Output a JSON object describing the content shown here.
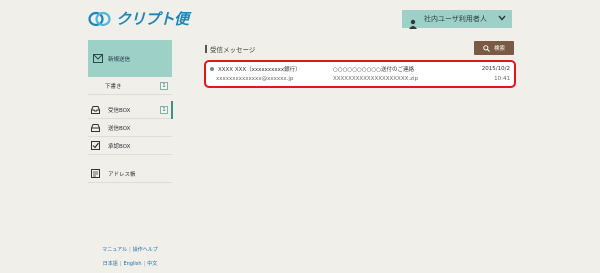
{
  "header": {
    "logo_text": "クリプト便",
    "user_name": "社内ユーザ利用者人",
    "user_icon": "person-icon",
    "dropdown_icon": "chevron-down-icon"
  },
  "sidebar": {
    "compose_label": "新規送信",
    "items": [
      {
        "label": "下書き",
        "count": "1",
        "icon": ""
      },
      {
        "label": "受信BOX",
        "count": "1",
        "icon": "inbox-icon"
      },
      {
        "label": "送信BOX",
        "count": "",
        "icon": "outbox-icon"
      },
      {
        "label": "承認BOX",
        "count": "",
        "icon": "checkbox-icon"
      },
      {
        "label": "アドレス帳",
        "count": "",
        "icon": "address-book-icon"
      }
    ],
    "help_links": [
      "マニュアル",
      "操作ヘルプ"
    ],
    "languages": [
      "日本語",
      "English",
      "中文"
    ]
  },
  "main": {
    "title": "受信メッセージ",
    "search_label": "検索",
    "messages": [
      {
        "sender": "XXXX XXX（xxxxxxxxxx銀行）",
        "subject": "○○○○○○○○○○送付のご連絡",
        "date": "2015/10/2",
        "email": "xxxxxxxxxxxxxx@xxxxxx.jp",
        "attachment": "XXXXXXXXXXXXXXXXXXXX.zip",
        "time": "10:41"
      }
    ]
  },
  "colors": {
    "accent": "#9dd1c8",
    "active_bar": "#3a9384",
    "search_button": "#7a5a45",
    "highlight_border": "#e2161b",
    "logo": "#1c86b8"
  }
}
